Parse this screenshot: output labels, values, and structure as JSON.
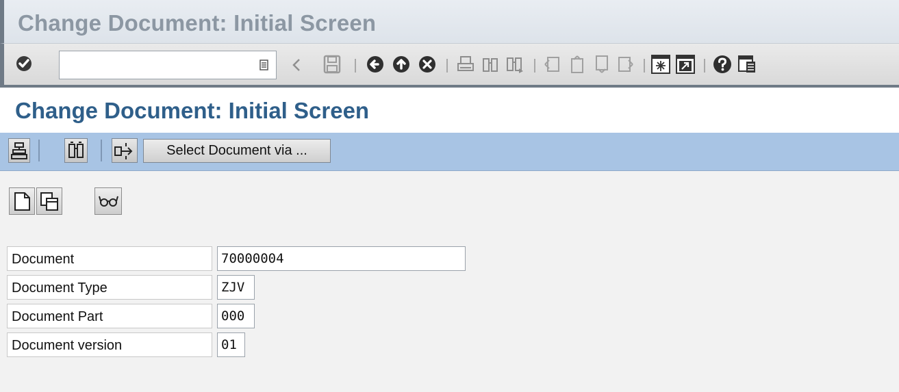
{
  "window": {
    "title": "Change Document: Initial Screen"
  },
  "standard_toolbar": {
    "command_field_value": "",
    "icons": [
      "enter-check-icon",
      "command-dropdown-icon",
      "previous-arrow-icon",
      "save-icon",
      "back-icon",
      "exit-icon",
      "cancel-icon",
      "print-icon",
      "find-icon",
      "find-next-icon",
      "first-page-icon",
      "previous-page-icon",
      "next-page-icon",
      "last-page-icon",
      "create-session-icon",
      "shortcut-icon",
      "help-icon",
      "customize-layout-icon"
    ]
  },
  "screen": {
    "title": "Change Document: Initial Screen"
  },
  "app_toolbar": {
    "icons": [
      "hierarchy-icon",
      "find-icon",
      "transfer-icon"
    ],
    "select_document_button": "Select Document via ..."
  },
  "content_toolbar": {
    "icons": [
      "new-document-icon",
      "copy-document-icon",
      "display-glasses-icon"
    ]
  },
  "form": {
    "fields": [
      {
        "label": "Document",
        "value": "70000004"
      },
      {
        "label": "Document Type",
        "value": "ZJV"
      },
      {
        "label": "Document Part",
        "value": "000"
      },
      {
        "label": "Document version",
        "value": "01"
      }
    ]
  },
  "colors": {
    "title_text": "#2f5f8a",
    "window_title_text": "#8c97a3",
    "app_toolbar_bg": "#a8c4e4",
    "content_bg": "#f2f2f2"
  }
}
